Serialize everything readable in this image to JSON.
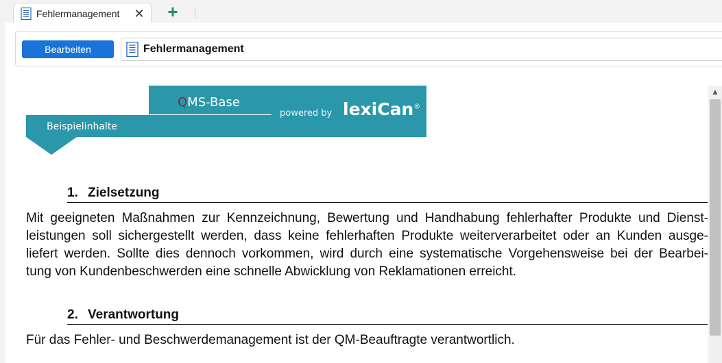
{
  "tabs": [
    {
      "label": "Fehlermanagement",
      "icon": "document-icon",
      "active": true
    }
  ],
  "tab_actions": {
    "close_symbol": "✕",
    "new_tab_symbol": "+"
  },
  "toolbar": {
    "edit_label": "Bearbeiten",
    "document_title": "Fehlermanagement",
    "document_icon": "document-icon"
  },
  "banner": {
    "qms_q": "Q",
    "qms_rest": "MS-Base",
    "sample_label": "Beispielinhalte",
    "powered_by": "powered by",
    "brand": "lexiCan",
    "brand_mark": "®",
    "color": "#2b97aa",
    "q_color": "#7d2b3c"
  },
  "sections": [
    {
      "number": "1.",
      "title": "Zielsetzung",
      "lines": [
        "Mit geeigneten Maßnahmen zur Kennzeichnung, Bewertung und Handhabung fehlerhafter Produkte und Dienst-",
        "leistungen soll sichergestellt werden, dass keine fehlerhaften Produkte weiterverarbeitet oder an Kunden ausge-",
        "liefert werden. Sollte dies dennoch vorkommen, wird durch eine systematische Vorgehensweise bei der Bearbei-",
        "tung von Kundenbeschwerden eine schnelle Abwicklung von Reklamationen erreicht."
      ]
    },
    {
      "number": "2.",
      "title": "Verantwortung",
      "lines": [
        "Für das Fehler- und Beschwerdemanagement ist der QM-Beauftragte verantwortlich."
      ]
    }
  ],
  "colors": {
    "accent": "#1a73d9",
    "new_tab": "#1f8a70"
  }
}
